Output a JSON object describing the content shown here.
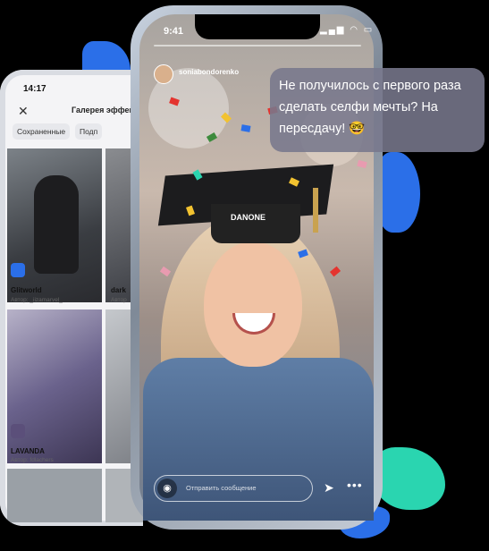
{
  "colors": {
    "accent_blue": "#2b6fe8",
    "accent_teal": "#2ad5b0",
    "bubble_bg": "#78788c"
  },
  "gallery": {
    "status_time": "14:17",
    "title": "Галерея эффек",
    "close_icon": "close-icon",
    "tabs": [
      "Сохраненные",
      "Подп"
    ],
    "tiles": [
      {
        "name": "Glitworld",
        "author": "Автор: _iizamarvel_"
      },
      {
        "name": "dark",
        "author": "Автор"
      },
      {
        "name": "LAVANDA",
        "author": "Автор: fdlachers"
      },
      {
        "name": "",
        "author": ""
      }
    ]
  },
  "story": {
    "status_time": "9:41",
    "username": "soniabondorenko",
    "message_placeholder": "Отправить сообщение",
    "camera_icon": "camera-icon",
    "send_icon": "send-icon",
    "more_icon": "more-icon",
    "cap_logo": "DANONE"
  },
  "bubble": {
    "text": "Не получилось с первого раза сделать селфи мечты? На пересдачу! 🤓"
  }
}
